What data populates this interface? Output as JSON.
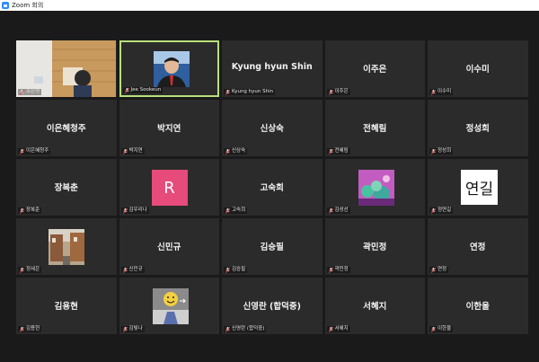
{
  "window": {
    "title": "Zoom 회의"
  },
  "colors": {
    "active_speaker": "#b7e07a",
    "tile_bg": "#2b2b2b",
    "stage_bg": "#1a1a1a",
    "muted": "#e03c3c"
  },
  "participants": [
    {
      "name": "",
      "label": "조은영",
      "kind": "video"
    },
    {
      "name": "",
      "label": "Jee Sookeun",
      "kind": "photo",
      "active": true
    },
    {
      "name": "Kyung hyun Shin",
      "label": "Kyung hyun Shin",
      "kind": "name"
    },
    {
      "name": "이주은",
      "label": "이주은",
      "kind": "name"
    },
    {
      "name": "이수미",
      "label": "이수미",
      "kind": "name"
    },
    {
      "name": "이은혜청주",
      "label": "이은혜청주",
      "kind": "name"
    },
    {
      "name": "박지연",
      "label": "박지연",
      "kind": "name"
    },
    {
      "name": "신상숙",
      "label": "신상숙",
      "kind": "name"
    },
    {
      "name": "전혜림",
      "label": "전혜림",
      "kind": "name"
    },
    {
      "name": "정성희",
      "label": "정성희",
      "kind": "name"
    },
    {
      "name": "장복춘",
      "label": "장복춘",
      "kind": "name"
    },
    {
      "name": "",
      "label": "김우리나",
      "kind": "letter",
      "avatar_text": "R"
    },
    {
      "name": "고숙희",
      "label": "고숙희",
      "kind": "name"
    },
    {
      "name": "",
      "label": "김성선",
      "kind": "image"
    },
    {
      "name": "",
      "label": "정연길",
      "kind": "text-avatar",
      "avatar_text": "연길"
    },
    {
      "name": "",
      "label": "정세은",
      "kind": "photo2"
    },
    {
      "name": "신민규",
      "label": "신민규",
      "kind": "name"
    },
    {
      "name": "김승필",
      "label": "김승필",
      "kind": "name"
    },
    {
      "name": "곽민정",
      "label": "곽민정",
      "kind": "name"
    },
    {
      "name": "연정",
      "label": "연정",
      "kind": "name"
    },
    {
      "name": "김용현",
      "label": "김용현",
      "kind": "name"
    },
    {
      "name": "",
      "label": "김빛나",
      "kind": "smile"
    },
    {
      "name": "신영란 (합덕중)",
      "label": "신영란 (합덕중)",
      "kind": "name"
    },
    {
      "name": "서혜지",
      "label": "서혜지",
      "kind": "name"
    },
    {
      "name": "이한울",
      "label": "이한울",
      "kind": "name"
    }
  ]
}
